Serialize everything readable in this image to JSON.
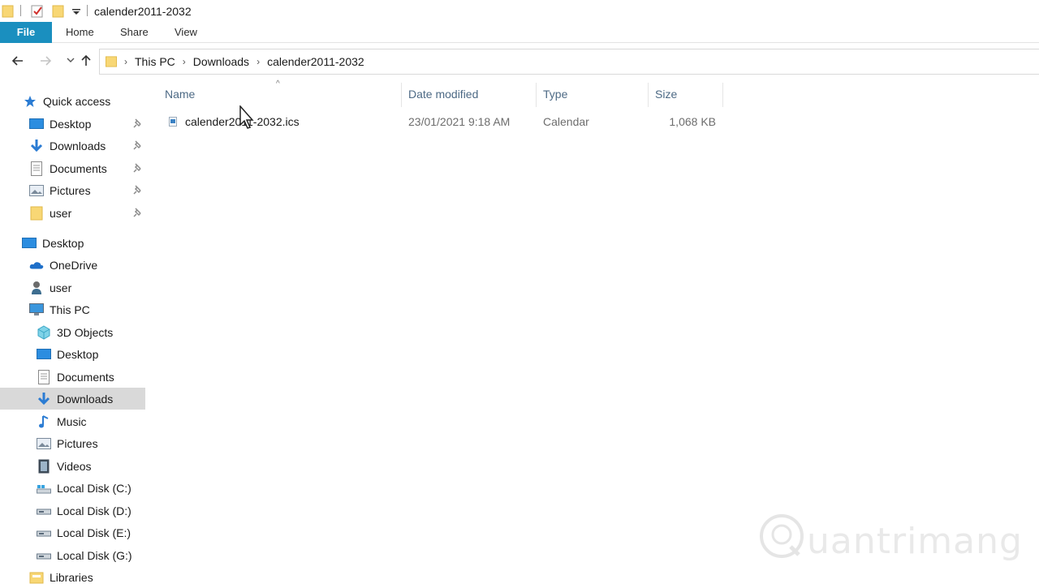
{
  "window": {
    "title": "calender2011-2032"
  },
  "ribbon": {
    "tabs": [
      {
        "label": "File"
      },
      {
        "label": "Home"
      },
      {
        "label": "Share"
      },
      {
        "label": "View"
      }
    ]
  },
  "breadcrumb": [
    "This PC",
    "Downloads",
    "calender2011-2032"
  ],
  "sidebar": {
    "quick_access": {
      "label": "Quick access",
      "items": [
        {
          "label": "Desktop",
          "icon": "desktop-icon",
          "pinned": true
        },
        {
          "label": "Downloads",
          "icon": "downloads-icon",
          "pinned": true
        },
        {
          "label": "Documents",
          "icon": "documents-icon",
          "pinned": true
        },
        {
          "label": "Pictures",
          "icon": "pictures-icon",
          "pinned": true
        },
        {
          "label": "user",
          "icon": "folder-icon",
          "pinned": true
        }
      ]
    },
    "tree": [
      {
        "label": "Desktop",
        "icon": "desktop-icon"
      },
      {
        "label": "OneDrive",
        "icon": "onedrive-icon"
      },
      {
        "label": "user",
        "icon": "user-icon"
      },
      {
        "label": "This PC",
        "icon": "this-pc-icon"
      },
      {
        "label": "3D Objects",
        "icon": "3d-objects-icon"
      },
      {
        "label": "Desktop",
        "icon": "desktop-icon"
      },
      {
        "label": "Documents",
        "icon": "documents-icon"
      },
      {
        "label": "Downloads",
        "icon": "downloads-icon",
        "selected": true
      },
      {
        "label": "Music",
        "icon": "music-icon"
      },
      {
        "label": "Pictures",
        "icon": "pictures-icon"
      },
      {
        "label": "Videos",
        "icon": "videos-icon"
      },
      {
        "label": "Local Disk (C:)",
        "icon": "system-drive-icon"
      },
      {
        "label": "Local Disk (D:)",
        "icon": "drive-icon"
      },
      {
        "label": "Local Disk (E:)",
        "icon": "drive-icon"
      },
      {
        "label": "Local Disk (G:)",
        "icon": "drive-icon"
      },
      {
        "label": "Libraries",
        "icon": "libraries-icon"
      }
    ]
  },
  "file_list": {
    "columns": [
      "Name",
      "Date modified",
      "Type",
      "Size"
    ],
    "rows": [
      {
        "name": "calender2011-2032.ics",
        "date_modified": "23/01/2021 9:18 AM",
        "type": "Calendar",
        "size": "1,068 KB"
      }
    ]
  },
  "watermark": {
    "text": "uantrimang"
  },
  "colors": {
    "file_tab": "#1a8fbf",
    "selected_item": "#d9d9d9",
    "column_header": "#4d6a85"
  }
}
